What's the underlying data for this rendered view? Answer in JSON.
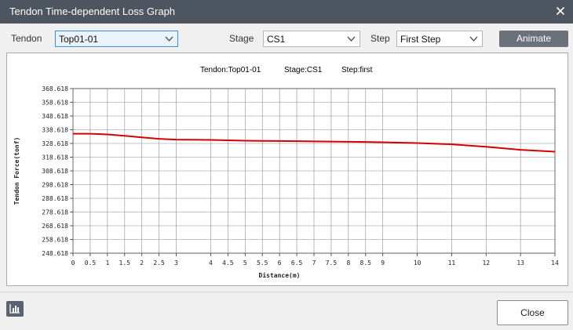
{
  "window": {
    "title": "Tendon Time-dependent Loss Graph"
  },
  "controls": {
    "tendon_label": "Tendon",
    "tendon_value": "Top01-01",
    "stage_label": "Stage",
    "stage_value": "CS1",
    "step_label": "Step",
    "step_value": "First Step",
    "animate_label": "Animate"
  },
  "chart_data": {
    "type": "line",
    "header": [
      "Tendon:Top01-01",
      "Stage:CS1",
      "Step:first"
    ],
    "xlabel": "Distance(m)",
    "ylabel": "Tendon Force(tonf)",
    "xlim": [
      0,
      14
    ],
    "ylim": [
      248.618,
      368.618
    ],
    "xticks": [
      0,
      0.5,
      1,
      1.5,
      2,
      2.5,
      3,
      4,
      4.5,
      5,
      5.5,
      6,
      6.5,
      7,
      7.5,
      8,
      8.5,
      9,
      10,
      11,
      12,
      13,
      14
    ],
    "yticks": [
      248.618,
      258.618,
      268.618,
      278.618,
      288.618,
      298.618,
      308.618,
      318.618,
      328.618,
      338.618,
      348.618,
      358.618,
      368.618
    ],
    "ytick_labels": [
      "248.618",
      "258.618",
      "268.618",
      "278.618",
      "288.618",
      "298.618",
      "308.618",
      "318.618",
      "328.618",
      "338.618",
      "348.618",
      "358.618",
      "368.618"
    ],
    "grid": true,
    "series": [
      {
        "color": "#d40000",
        "x": [
          0,
          0.5,
          1,
          1.5,
          2,
          2.5,
          3,
          4,
          4.5,
          5,
          5.5,
          6,
          6.5,
          7,
          7.5,
          8,
          8.5,
          9,
          10,
          11,
          12,
          13,
          14
        ],
        "y": [
          335.7,
          335.7,
          335.2,
          334.2,
          333.1,
          332.0,
          331.4,
          331.2,
          330.9,
          330.6,
          330.5,
          330.4,
          330.3,
          330.1,
          330.0,
          329.8,
          329.7,
          329.5,
          328.9,
          328.0,
          326.2,
          324.0,
          322.6
        ]
      }
    ]
  },
  "footer": {
    "close_label": "Close"
  },
  "icons": {
    "close": "close-icon",
    "chart": "bar-chart-icon",
    "dropdown": "chevron-down-icon"
  }
}
